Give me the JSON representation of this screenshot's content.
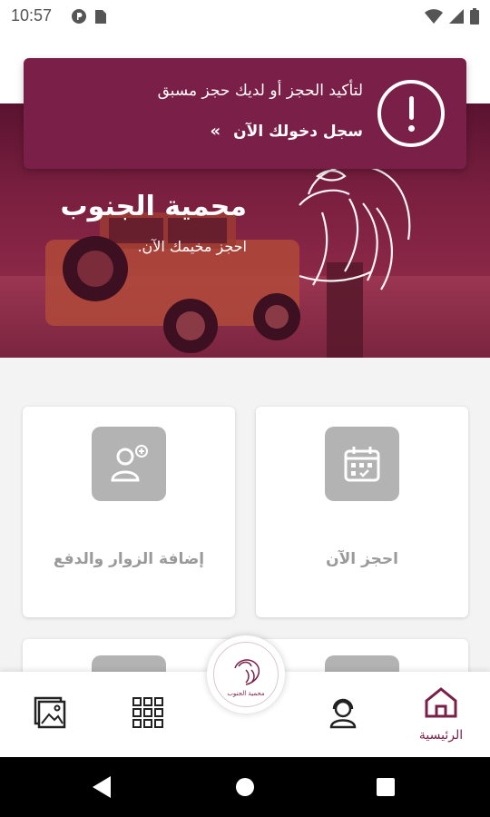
{
  "status_bar": {
    "time": "10:57",
    "left_icons": [
      "p-circle-icon",
      "sim-icon"
    ],
    "right_icons": [
      "wifi-icon",
      "signal-icon",
      "battery-icon"
    ]
  },
  "banner": {
    "message": "لتأكيد الحجز أو لديك حجز مسبق",
    "link_text": "سجل دخولك الآن",
    "chevrons": "»",
    "icon": "exclamation-circle-icon",
    "color": "#7a1f47"
  },
  "hero": {
    "title": "محمية الجنوب",
    "subtitle": "احجز مخيمك الآن."
  },
  "cards": [
    {
      "label": "احجز الآن",
      "icon": "calendar-icon"
    },
    {
      "label": "إضافة الزوار والدفع",
      "icon": "add-user-icon"
    }
  ],
  "bottom_nav": {
    "items": [
      {
        "label": "الرئيسية",
        "icon": "home-icon",
        "active": true
      },
      {
        "label": "",
        "icon": "support-agent-icon",
        "active": false
      },
      {
        "label": "",
        "icon": "grid-icon",
        "active": false
      },
      {
        "label": "",
        "icon": "gallery-icon",
        "active": false
      }
    ],
    "center_logo_text": "محمية الجنوب"
  },
  "colors": {
    "brand": "#7a1f47",
    "card_icon_bg": "#b3b3b3",
    "card_label": "#9a9a9a"
  }
}
